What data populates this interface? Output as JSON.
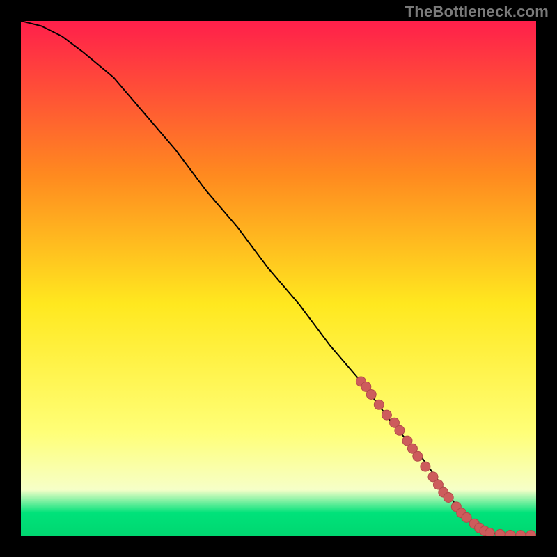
{
  "watermark": "TheBottleneck.com",
  "colors": {
    "bg": "#000000",
    "watermark": "#7a7a7a",
    "curve": "#000000",
    "dot_fill": "#cd5c5c",
    "dot_stroke": "#b24a4a",
    "grad_top": "#ff1f4b",
    "grad_mid1": "#ff8a1f",
    "grad_mid2": "#ffe81f",
    "grad_mid3": "#ffff78",
    "grad_pale": "#f6ffc8",
    "grad_green": "#00e27a",
    "grad_bottom": "#00d770"
  },
  "chart_data": {
    "type": "line",
    "title": "",
    "xlabel": "",
    "ylabel": "",
    "xlim": [
      0,
      100
    ],
    "ylim": [
      0,
      100
    ],
    "series": [
      {
        "name": "curve",
        "x": [
          0,
          4,
          8,
          12,
          18,
          24,
          30,
          36,
          42,
          48,
          54,
          60,
          66,
          72,
          78,
          83,
          86,
          88,
          90,
          92,
          94,
          96,
          98,
          100
        ],
        "y": [
          100,
          99,
          97,
          94,
          89,
          82,
          75,
          67,
          60,
          52,
          45,
          37,
          30,
          22,
          15,
          8,
          4,
          2,
          1,
          0.5,
          0.3,
          0.2,
          0.15,
          0.15
        ]
      }
    ],
    "dots": {
      "name": "highlighted-points",
      "x": [
        66,
        67,
        68,
        69.5,
        71,
        72.5,
        73.5,
        75,
        76,
        77,
        78.5,
        80,
        81,
        82,
        83,
        84.5,
        85.5,
        86.5,
        88,
        89,
        90,
        91,
        93,
        95,
        97,
        99
      ],
      "y": [
        30,
        29,
        27.5,
        25.5,
        23.5,
        22,
        20.5,
        18.5,
        17,
        15.5,
        13.5,
        11.5,
        10,
        8.5,
        7.5,
        5.7,
        4.5,
        3.6,
        2.4,
        1.6,
        1.0,
        0.6,
        0.35,
        0.2,
        0.18,
        0.18
      ]
    },
    "gradient_stops": [
      {
        "offset": 0.0,
        "color_key": "grad_top"
      },
      {
        "offset": 0.3,
        "color_key": "grad_mid1"
      },
      {
        "offset": 0.55,
        "color_key": "grad_mid2"
      },
      {
        "offset": 0.8,
        "color_key": "grad_mid3"
      },
      {
        "offset": 0.91,
        "color_key": "grad_pale"
      },
      {
        "offset": 0.955,
        "color_key": "grad_green"
      },
      {
        "offset": 1.0,
        "color_key": "grad_bottom"
      }
    ]
  }
}
